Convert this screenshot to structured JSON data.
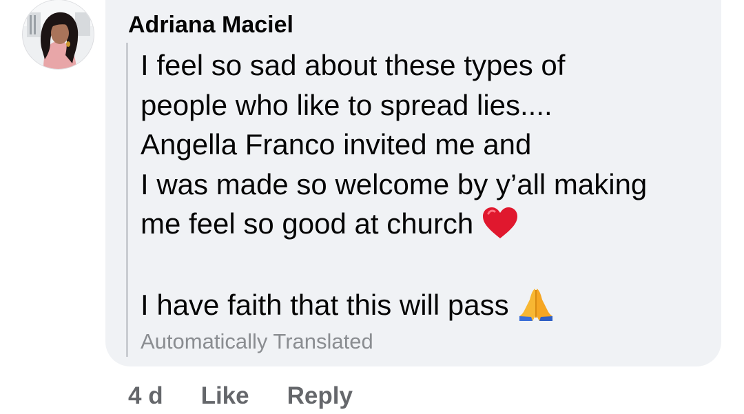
{
  "comment": {
    "author": "Adriana Maciel",
    "avatar_icon": "profile-photo",
    "lines": [
      "I feel so sad about these types of",
      "people who like to spread lies....",
      "Angella Franco invited me and",
      "I was made so welcome by y’all making",
      "me feel so good at church",
      "",
      "I have faith that this will pass"
    ],
    "emojis": {
      "heart": "red-heart-emoji",
      "hands": "folded-hands-emoji"
    },
    "translation_note": "Automatically Translated"
  },
  "actions": {
    "timestamp": "4 d",
    "like_label": "Like",
    "reply_label": "Reply"
  },
  "colors": {
    "bubble": "#f0f2f5",
    "text": "#050505",
    "secondary_text": "#65676b",
    "muted_text": "#8a8d91",
    "heart": "#e0182e",
    "hands": "#f7b733"
  }
}
